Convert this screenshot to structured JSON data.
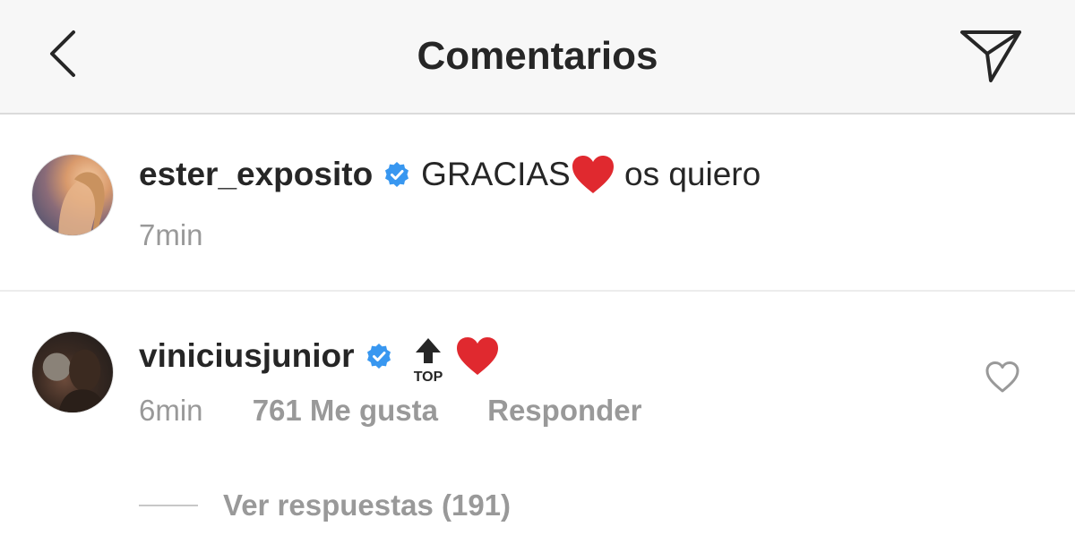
{
  "header": {
    "title": "Comentarios",
    "back_icon": "chevron-left-icon",
    "send_icon": "paper-plane-icon"
  },
  "comments": [
    {
      "username": "ester_exposito",
      "verified": true,
      "text_before": "GRACIAS",
      "text_after": " os quiero",
      "time": "7min"
    },
    {
      "username": "viniciusjunior",
      "verified": true,
      "emoji_top_label": "TOP",
      "time": "6min",
      "likes": "761 Me gusta",
      "reply_label": "Responder",
      "view_replies": "Ver respuestas (191)"
    }
  ],
  "colors": {
    "verified_blue": "#3897f0",
    "heart_red": "#e0292f",
    "muted_text": "#999999",
    "header_bg": "#f7f7f7"
  }
}
